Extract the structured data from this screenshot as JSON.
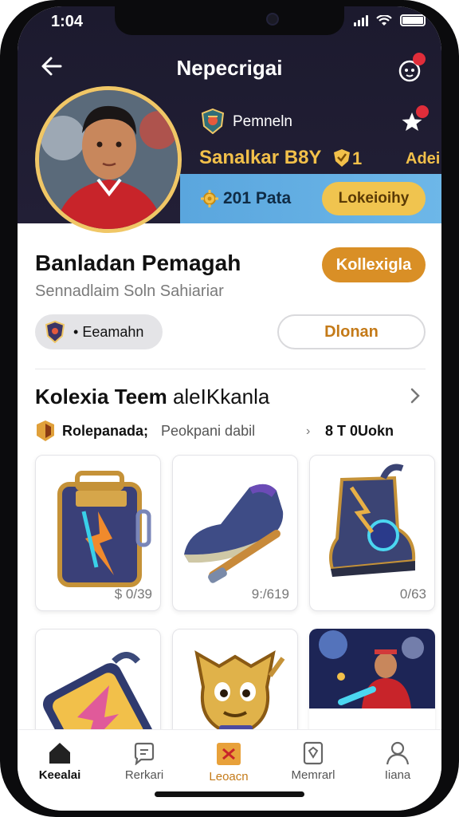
{
  "status": {
    "time": "1:04"
  },
  "header": {
    "title": "Nepecrigai"
  },
  "profile": {
    "team_name": "Pemneln",
    "player_name": "Sanalkar B8Y",
    "level": "1",
    "extra_label": "Adei",
    "points": "201 Pata",
    "points_button": "Lokeioihy"
  },
  "info": {
    "title": "Banladan Pemagah",
    "subtitle": "Sennadlaim Soln Sahiariar",
    "collect_button": "Kollexigla",
    "chip_label": "Eeamahn",
    "outline_button": "Dlonan"
  },
  "collection": {
    "title_bold": "Kolexia Teem",
    "title_light": "aleIKkanla",
    "filter_a": "Rolepanada;",
    "filter_b": "Peokpani dabil",
    "filter_arrow": "›",
    "filter_c": "8 T 0Uokn",
    "items": [
      {
        "price": "$ 0/39",
        "icon": "backpack-icon"
      },
      {
        "price": "9:/619",
        "icon": "sneaker-icon"
      },
      {
        "price": "0/63",
        "icon": "boot-icon"
      },
      {
        "price": "",
        "icon": "luggage-icon"
      },
      {
        "price": "",
        "icon": "mascot-icon"
      },
      {
        "price": "",
        "icon": "player-photo"
      }
    ]
  },
  "nav": [
    {
      "label": "Keealai",
      "icon": "home-icon"
    },
    {
      "label": "Rerkari",
      "icon": "chat-icon"
    },
    {
      "label": "Leoacn",
      "icon": "collection-icon"
    },
    {
      "label": "Memrarl",
      "icon": "card-icon"
    },
    {
      "label": "Iiana",
      "icon": "person-icon"
    }
  ],
  "colors": {
    "accent": "#d98f26",
    "gold": "#f2c04a",
    "header_bg": "#1c1a2e",
    "points_bg": "#5aa6de"
  }
}
